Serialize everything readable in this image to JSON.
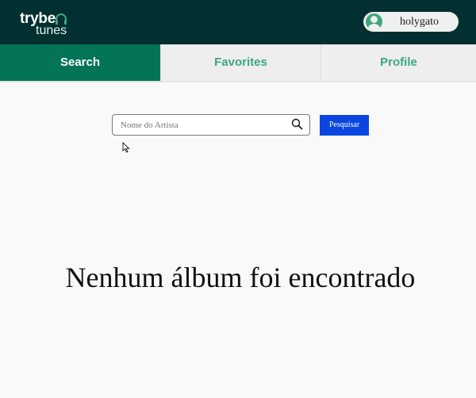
{
  "header": {
    "logo_top": "trybe",
    "logo_bottom": "tunes",
    "logo_icon": "headphones-icon",
    "username": "holygato",
    "avatar_icon": "user-icon"
  },
  "nav": {
    "tabs": [
      {
        "label": "Search",
        "active": true
      },
      {
        "label": "Favorites",
        "active": false
      },
      {
        "label": "Profile",
        "active": false
      }
    ]
  },
  "search": {
    "placeholder": "Nome do Artista",
    "value": "",
    "icon": "search-icon",
    "button_label": "Pesquisar"
  },
  "main": {
    "empty_message": "Nenhum álbum foi encontrado"
  },
  "colors": {
    "header_bg": "#023031",
    "active_tab_bg": "#037458",
    "tab_text": "#3ca67f",
    "button_bg": "#0a45e0",
    "page_bg": "#f9f9f9"
  }
}
